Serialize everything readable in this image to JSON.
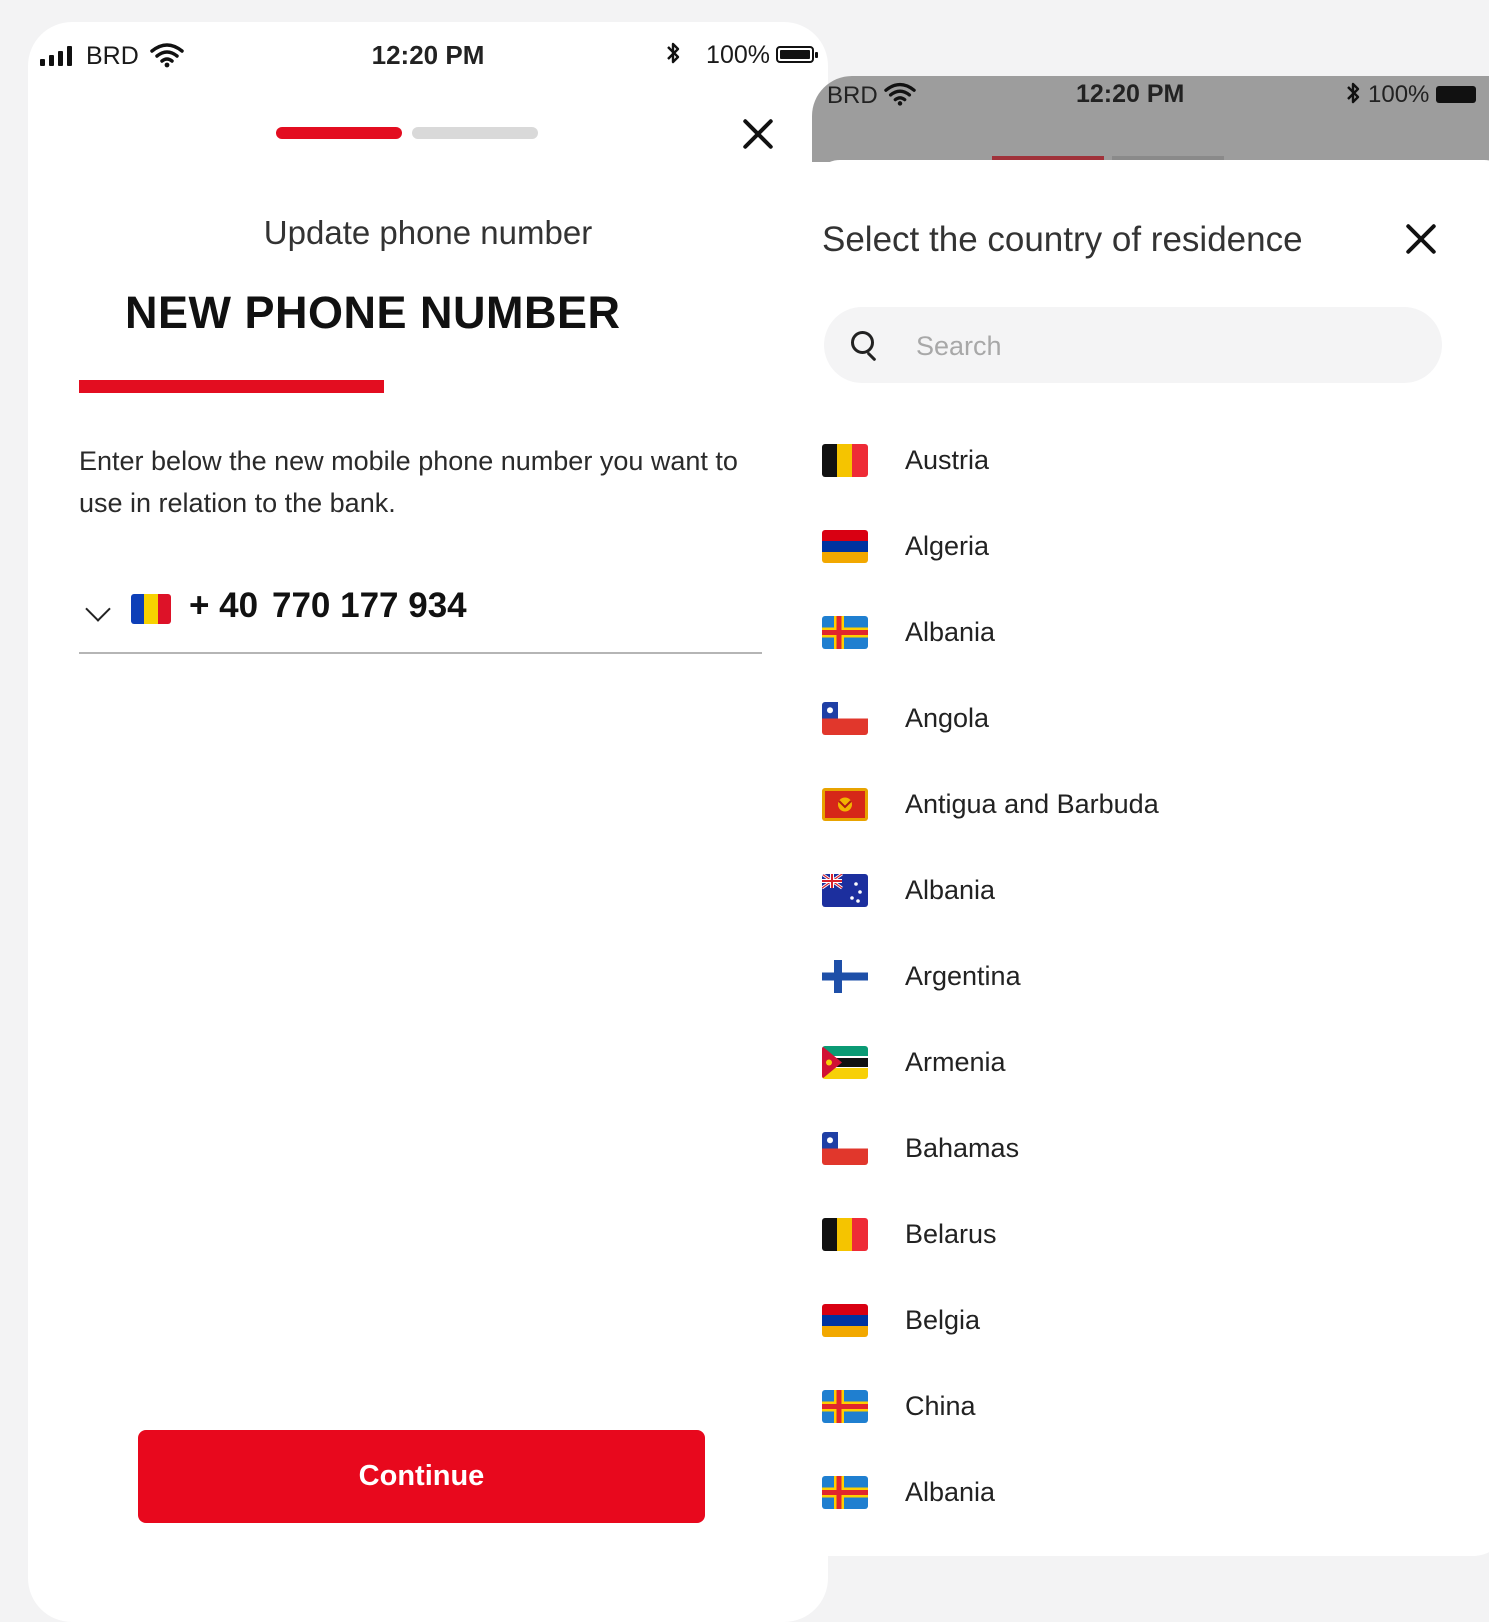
{
  "left_screen": {
    "status_bar": {
      "carrier": "BRD",
      "time": "12:20 PM",
      "battery": "100%"
    },
    "progress": {
      "total_steps": 2,
      "current_step": 1
    },
    "subtitle": "Update phone number",
    "heading": "NEW PHONE NUMBER",
    "description": "Enter below the new mobile phone number you want to use in relation to the bank.",
    "phone_field": {
      "country_code": "+ 40",
      "number": "770 177 934",
      "flag_colors": [
        "#0d3fb8",
        "#f7d200",
        "#dd1228"
      ]
    },
    "continue_label": "Continue"
  },
  "right_screen": {
    "status_bar": {
      "carrier": "BRD",
      "time": "12:20 PM",
      "battery": "100%"
    },
    "title": "Select the country of residence",
    "search": {
      "placeholder": "Search",
      "value": ""
    },
    "countries": [
      {
        "name": "Austria",
        "flag": "tricolor-vertical-black-yellow-red"
      },
      {
        "name": "Algeria",
        "flag": "tricolor-horizontal-red-blue-orange"
      },
      {
        "name": "Albania",
        "flag": "nordic-cross-blue-yellow-red"
      },
      {
        "name": "Angola",
        "flag": "chile-style-white-red-blue"
      },
      {
        "name": "Antigua and Barbuda",
        "flag": "red-gold-emblem"
      },
      {
        "name": "Albania",
        "flag": "blue-union-jack-stars"
      },
      {
        "name": "Argentina",
        "flag": "nordic-cross-white-blue"
      },
      {
        "name": "Armenia",
        "flag": "mozambique-style"
      },
      {
        "name": "Bahamas",
        "flag": "chile-style-white-red-blue"
      },
      {
        "name": "Belarus",
        "flag": "tricolor-vertical-black-yellow-red"
      },
      {
        "name": "Belgia",
        "flag": "tricolor-horizontal-red-blue-orange"
      },
      {
        "name": "China",
        "flag": "nordic-cross-blue-yellow-red"
      },
      {
        "name": "Albania",
        "flag": "nordic-cross-blue-yellow-red"
      }
    ]
  },
  "colors": {
    "brand_red": "#e30d20",
    "button_red": "#e8081d",
    "inactive_step": "#d9d9d9",
    "search_bg": "#f4f4f5"
  }
}
